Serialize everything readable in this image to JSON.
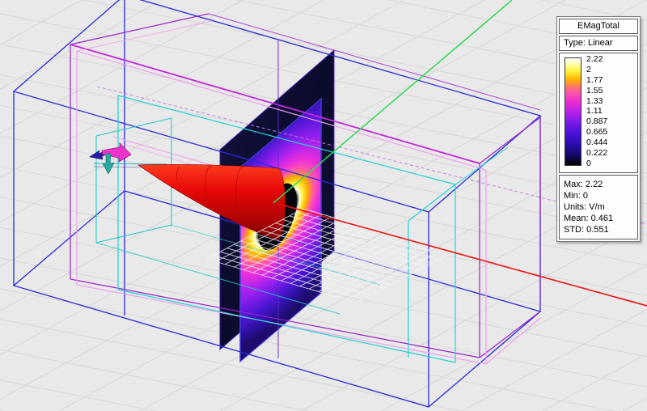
{
  "viewport": {
    "background_color": "#e9e9e9",
    "grid_color": "#d8d8d8",
    "axis_x_color": "#ee1010",
    "axis_y_color": "#30d858",
    "outer_box_color": "#2a2ad8",
    "inner_box_colors": [
      "#9a22cc",
      "#f0a0ee",
      "#20d4d4"
    ],
    "feed_arrow_colors": {
      "right": "#ee33cc",
      "left": "#2a1aa8",
      "down": "#28a8a0"
    },
    "cone_color": "#e80808",
    "field_plane": {
      "quantity": "EMagTotal",
      "min_color": "#000000",
      "max_color": "#ffffff",
      "aperture": "elliptical-hole"
    }
  },
  "legend": {
    "title": "EMagTotal",
    "type_label": "Type: Linear",
    "scale_ticks": [
      "2.22",
      "2",
      "1.77",
      "1.55",
      "1.33",
      "1.11",
      "0.887",
      "0.665",
      "0.444",
      "0.222",
      "0"
    ],
    "stats": [
      "Max: 2.22",
      "Min: 0",
      "Units: V/m",
      "Mean: 0.461",
      "STD: 0.551"
    ],
    "colormap_stops": [
      "#ffffff",
      "#fff23c",
      "#ffb400",
      "#f857a8",
      "#ee2fd0",
      "#b822e8",
      "#7c1ae8",
      "#4a12d8",
      "#2a0eb0",
      "#140870",
      "#000000"
    ]
  }
}
